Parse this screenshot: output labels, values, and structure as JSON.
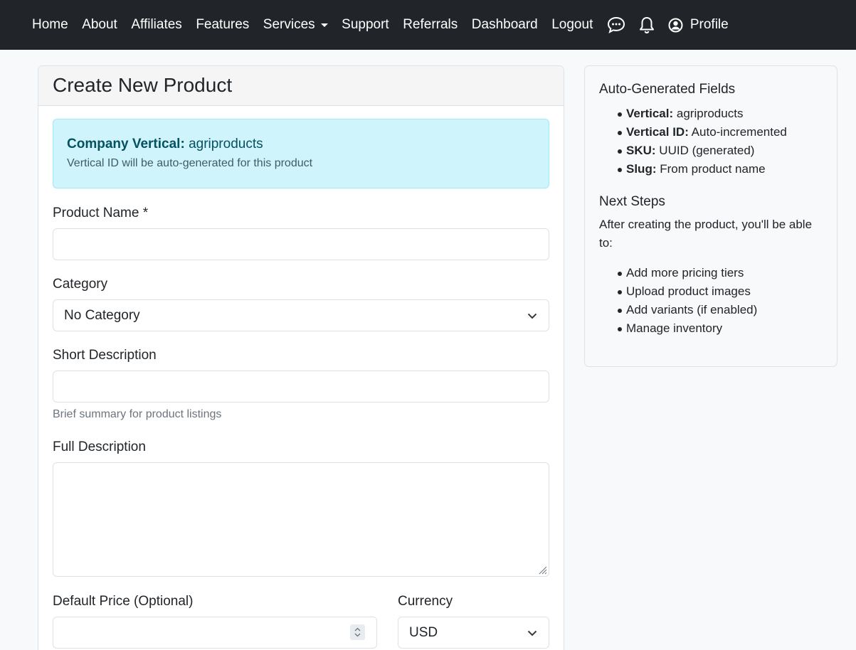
{
  "nav": {
    "items": [
      "Home",
      "About",
      "Affiliates",
      "Features",
      "Services",
      "Support",
      "Referrals",
      "Dashboard",
      "Logout"
    ],
    "profile_label": "Profile",
    "icons": [
      "chat-icon",
      "bell-icon",
      "user-circle-icon"
    ]
  },
  "form": {
    "title": "Create New Product",
    "alert": {
      "label": "Company Vertical:",
      "value": "agriproducts",
      "note": "Vertical ID will be auto-generated for this product"
    },
    "product_name": {
      "label": "Product Name *",
      "value": "",
      "placeholder": ""
    },
    "category": {
      "label": "Category",
      "selected": "No Category"
    },
    "short_description": {
      "label": "Short Description",
      "value": "",
      "help": "Brief summary for product listings"
    },
    "full_description": {
      "label": "Full Description",
      "value": ""
    },
    "default_price": {
      "label": "Default Price (Optional)",
      "value": ""
    },
    "currency": {
      "label": "Currency",
      "selected": "USD"
    }
  },
  "sidebar": {
    "auto_title": "Auto-Generated Fields",
    "auto_fields": [
      {
        "key": "Vertical:",
        "value": "agriproducts"
      },
      {
        "key": "Vertical ID:",
        "value": "Auto-incremented"
      },
      {
        "key": "SKU:",
        "value": "UUID (generated)"
      },
      {
        "key": "Slug:",
        "value": "From product name"
      }
    ],
    "next_title": "Next Steps",
    "next_intro": "After creating the product, you'll be able to:",
    "next_steps": [
      "Add more pricing tiers",
      "Upload product images",
      "Add variants (if enabled)",
      "Manage inventory"
    ]
  },
  "colors": {
    "navbar_bg": "#212529",
    "alert_bg": "#cff4fc",
    "alert_text": "#055160",
    "page_bg": "#f8f9fa"
  }
}
